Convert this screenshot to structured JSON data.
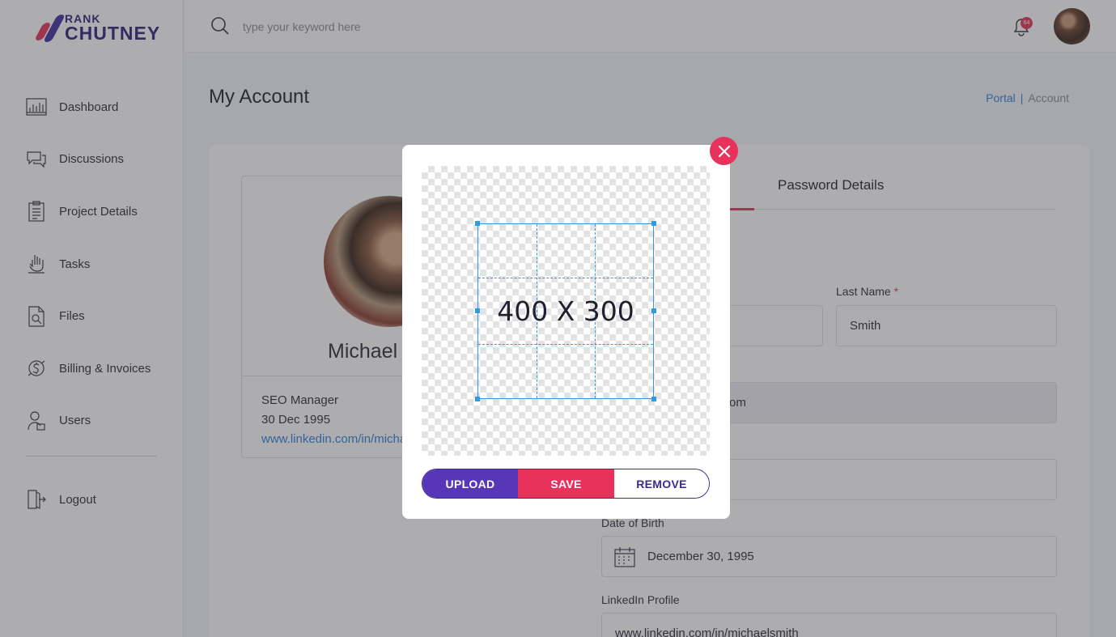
{
  "brand": {
    "line1": "RANK",
    "line2": "CHUTNEY"
  },
  "sidebar": {
    "items": [
      {
        "label": "Dashboard",
        "icon": "dashboard-icon"
      },
      {
        "label": "Discussions",
        "icon": "chat-icon"
      },
      {
        "label": "Project Details",
        "icon": "clipboard-icon"
      },
      {
        "label": "Tasks",
        "icon": "tasks-icon"
      },
      {
        "label": "Files",
        "icon": "file-search-icon"
      },
      {
        "label": "Billing & Invoices",
        "icon": "billing-icon"
      },
      {
        "label": "Users",
        "icon": "user-icon"
      }
    ],
    "logout": {
      "label": "Logout",
      "icon": "logout-icon"
    }
  },
  "header": {
    "search_placeholder": "type your keyword here",
    "notification_count": "64"
  },
  "page": {
    "title": "My Account",
    "breadcrumb": {
      "portal": "Portal",
      "separator": "|",
      "current": "Account"
    }
  },
  "profile": {
    "name": "Michael S",
    "role": "SEO Manager",
    "dob": "30 Dec 1995",
    "linkedin": "www.linkedin.com/in/micha"
  },
  "tabs": {
    "password": "Password Details"
  },
  "form": {
    "last_name_label": "Last Name",
    "last_name_required": "*",
    "last_name_value": "Smith",
    "email_partial": "om",
    "dob_label": "Date of Birth",
    "dob_value": "December 30, 1995",
    "linkedin_label": "LinkedIn Profile",
    "linkedin_value": "www.linkedin.com/in/michaelsmith"
  },
  "modal": {
    "crop_size_label": "400 X 300",
    "upload": "UPLOAD",
    "save": "SAVE",
    "remove": "REMOVE"
  },
  "colors": {
    "accent_pink": "#e8315b",
    "accent_purple": "#5737b8",
    "link_blue": "#2f7fd8",
    "crop_blue": "#2f9be0"
  }
}
